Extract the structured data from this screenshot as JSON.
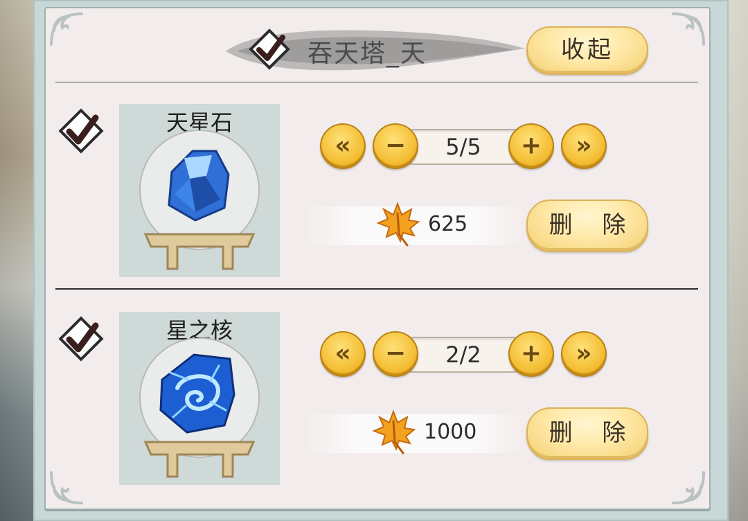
{
  "panel": {
    "title": "吞天塔_天",
    "collapse_label": "收起"
  },
  "items": [
    {
      "name": "天星石",
      "quantity": "5/5",
      "price": "625",
      "delete_label": "删 除",
      "selected": true,
      "gem_icon": "blue-crystal-icon"
    },
    {
      "name": "星之核",
      "quantity": "2/2",
      "price": "1000",
      "delete_label": "删 除",
      "selected": true,
      "gem_icon": "star-core-icon"
    }
  ],
  "controls": {
    "first_symbol": "«",
    "minus_symbol": "−",
    "plus_symbol": "+",
    "last_symbol": "»"
  },
  "colors": {
    "gold_button": "#f4bf35",
    "panel_bg": "#f3ecec",
    "card_bg": "#cfd9d7",
    "frame": "#c7d8d6"
  },
  "icons": {
    "check": "checkmark-icon",
    "currency": "maple-leaf-icon"
  }
}
